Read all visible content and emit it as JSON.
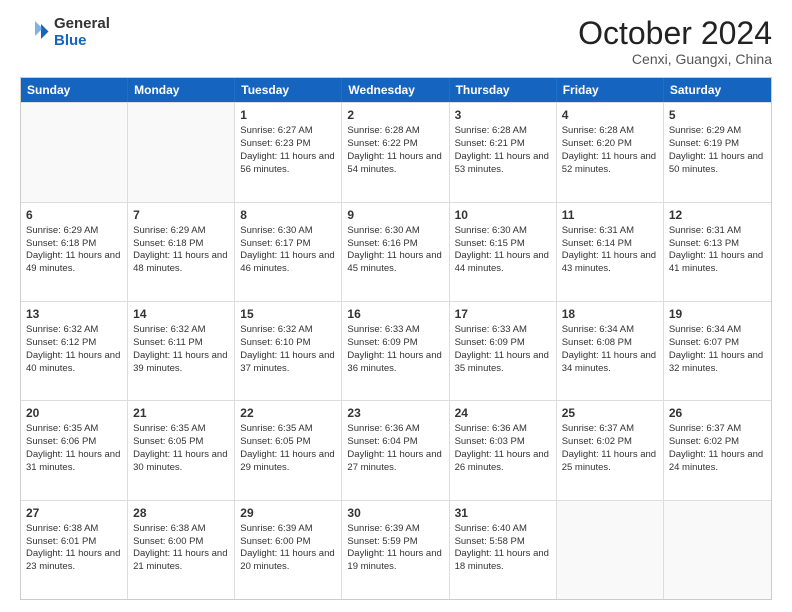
{
  "header": {
    "logo_general": "General",
    "logo_blue": "Blue",
    "month_year": "October 2024",
    "location": "Cenxi, Guangxi, China"
  },
  "days_of_week": [
    "Sunday",
    "Monday",
    "Tuesday",
    "Wednesday",
    "Thursday",
    "Friday",
    "Saturday"
  ],
  "weeks": [
    [
      {
        "day": "",
        "empty": true
      },
      {
        "day": "",
        "empty": true
      },
      {
        "day": "1",
        "sunrise": "Sunrise: 6:27 AM",
        "sunset": "Sunset: 6:23 PM",
        "daylight": "Daylight: 11 hours and 56 minutes."
      },
      {
        "day": "2",
        "sunrise": "Sunrise: 6:28 AM",
        "sunset": "Sunset: 6:22 PM",
        "daylight": "Daylight: 11 hours and 54 minutes."
      },
      {
        "day": "3",
        "sunrise": "Sunrise: 6:28 AM",
        "sunset": "Sunset: 6:21 PM",
        "daylight": "Daylight: 11 hours and 53 minutes."
      },
      {
        "day": "4",
        "sunrise": "Sunrise: 6:28 AM",
        "sunset": "Sunset: 6:20 PM",
        "daylight": "Daylight: 11 hours and 52 minutes."
      },
      {
        "day": "5",
        "sunrise": "Sunrise: 6:29 AM",
        "sunset": "Sunset: 6:19 PM",
        "daylight": "Daylight: 11 hours and 50 minutes."
      }
    ],
    [
      {
        "day": "6",
        "sunrise": "Sunrise: 6:29 AM",
        "sunset": "Sunset: 6:18 PM",
        "daylight": "Daylight: 11 hours and 49 minutes."
      },
      {
        "day": "7",
        "sunrise": "Sunrise: 6:29 AM",
        "sunset": "Sunset: 6:18 PM",
        "daylight": "Daylight: 11 hours and 48 minutes."
      },
      {
        "day": "8",
        "sunrise": "Sunrise: 6:30 AM",
        "sunset": "Sunset: 6:17 PM",
        "daylight": "Daylight: 11 hours and 46 minutes."
      },
      {
        "day": "9",
        "sunrise": "Sunrise: 6:30 AM",
        "sunset": "Sunset: 6:16 PM",
        "daylight": "Daylight: 11 hours and 45 minutes."
      },
      {
        "day": "10",
        "sunrise": "Sunrise: 6:30 AM",
        "sunset": "Sunset: 6:15 PM",
        "daylight": "Daylight: 11 hours and 44 minutes."
      },
      {
        "day": "11",
        "sunrise": "Sunrise: 6:31 AM",
        "sunset": "Sunset: 6:14 PM",
        "daylight": "Daylight: 11 hours and 43 minutes."
      },
      {
        "day": "12",
        "sunrise": "Sunrise: 6:31 AM",
        "sunset": "Sunset: 6:13 PM",
        "daylight": "Daylight: 11 hours and 41 minutes."
      }
    ],
    [
      {
        "day": "13",
        "sunrise": "Sunrise: 6:32 AM",
        "sunset": "Sunset: 6:12 PM",
        "daylight": "Daylight: 11 hours and 40 minutes."
      },
      {
        "day": "14",
        "sunrise": "Sunrise: 6:32 AM",
        "sunset": "Sunset: 6:11 PM",
        "daylight": "Daylight: 11 hours and 39 minutes."
      },
      {
        "day": "15",
        "sunrise": "Sunrise: 6:32 AM",
        "sunset": "Sunset: 6:10 PM",
        "daylight": "Daylight: 11 hours and 37 minutes."
      },
      {
        "day": "16",
        "sunrise": "Sunrise: 6:33 AM",
        "sunset": "Sunset: 6:09 PM",
        "daylight": "Daylight: 11 hours and 36 minutes."
      },
      {
        "day": "17",
        "sunrise": "Sunrise: 6:33 AM",
        "sunset": "Sunset: 6:09 PM",
        "daylight": "Daylight: 11 hours and 35 minutes."
      },
      {
        "day": "18",
        "sunrise": "Sunrise: 6:34 AM",
        "sunset": "Sunset: 6:08 PM",
        "daylight": "Daylight: 11 hours and 34 minutes."
      },
      {
        "day": "19",
        "sunrise": "Sunrise: 6:34 AM",
        "sunset": "Sunset: 6:07 PM",
        "daylight": "Daylight: 11 hours and 32 minutes."
      }
    ],
    [
      {
        "day": "20",
        "sunrise": "Sunrise: 6:35 AM",
        "sunset": "Sunset: 6:06 PM",
        "daylight": "Daylight: 11 hours and 31 minutes."
      },
      {
        "day": "21",
        "sunrise": "Sunrise: 6:35 AM",
        "sunset": "Sunset: 6:05 PM",
        "daylight": "Daylight: 11 hours and 30 minutes."
      },
      {
        "day": "22",
        "sunrise": "Sunrise: 6:35 AM",
        "sunset": "Sunset: 6:05 PM",
        "daylight": "Daylight: 11 hours and 29 minutes."
      },
      {
        "day": "23",
        "sunrise": "Sunrise: 6:36 AM",
        "sunset": "Sunset: 6:04 PM",
        "daylight": "Daylight: 11 hours and 27 minutes."
      },
      {
        "day": "24",
        "sunrise": "Sunrise: 6:36 AM",
        "sunset": "Sunset: 6:03 PM",
        "daylight": "Daylight: 11 hours and 26 minutes."
      },
      {
        "day": "25",
        "sunrise": "Sunrise: 6:37 AM",
        "sunset": "Sunset: 6:02 PM",
        "daylight": "Daylight: 11 hours and 25 minutes."
      },
      {
        "day": "26",
        "sunrise": "Sunrise: 6:37 AM",
        "sunset": "Sunset: 6:02 PM",
        "daylight": "Daylight: 11 hours and 24 minutes."
      }
    ],
    [
      {
        "day": "27",
        "sunrise": "Sunrise: 6:38 AM",
        "sunset": "Sunset: 6:01 PM",
        "daylight": "Daylight: 11 hours and 23 minutes."
      },
      {
        "day": "28",
        "sunrise": "Sunrise: 6:38 AM",
        "sunset": "Sunset: 6:00 PM",
        "daylight": "Daylight: 11 hours and 21 minutes."
      },
      {
        "day": "29",
        "sunrise": "Sunrise: 6:39 AM",
        "sunset": "Sunset: 6:00 PM",
        "daylight": "Daylight: 11 hours and 20 minutes."
      },
      {
        "day": "30",
        "sunrise": "Sunrise: 6:39 AM",
        "sunset": "Sunset: 5:59 PM",
        "daylight": "Daylight: 11 hours and 19 minutes."
      },
      {
        "day": "31",
        "sunrise": "Sunrise: 6:40 AM",
        "sunset": "Sunset: 5:58 PM",
        "daylight": "Daylight: 11 hours and 18 minutes."
      },
      {
        "day": "",
        "empty": true
      },
      {
        "day": "",
        "empty": true
      }
    ]
  ]
}
